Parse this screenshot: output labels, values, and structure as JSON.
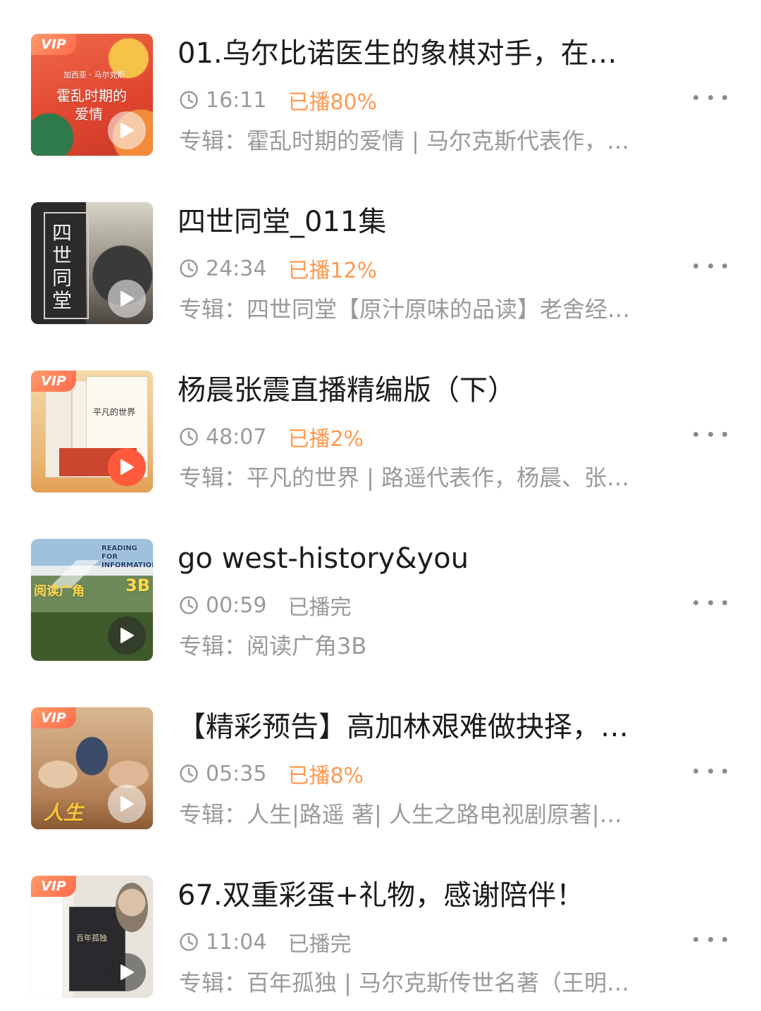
{
  "episodes": [
    {
      "title": "01.乌尔比诺医生的象棋对手，在…",
      "duration": "16:11",
      "played": "已播80%",
      "played_state": "partial",
      "album": "专辑：霍乱时期的爱情 | 马尔克斯代表作，…",
      "vip": "VIP",
      "cover_line1": "加西亚 · 马尔克斯",
      "cover_line2": "霍乱时期的",
      "cover_line3": "爱情",
      "cover_color": "#e8503a"
    },
    {
      "title": "四世同堂_011集",
      "duration": "24:34",
      "played": "已播12%",
      "played_state": "partial",
      "album": "专辑：四世同堂【原汁原味的品读】老舍经…",
      "vip": "",
      "cover_line1": "四",
      "cover_line2": "世",
      "cover_line3": "同",
      "cover_line4": "堂",
      "cover_color": "#5a5a5a"
    },
    {
      "title": "杨晨张震直播精编版（下）",
      "duration": "48:07",
      "played": "已播2%",
      "played_state": "partial",
      "album": "专辑：平凡的世界 | 路遥代表作，杨晨、张…",
      "vip": "VIP",
      "cover_line1": "平凡的世界",
      "cover_color": "#f0c48a"
    },
    {
      "title": "go west-history&you",
      "duration": "00:59",
      "played": "已播完",
      "played_state": "done",
      "album": "专辑：阅读广角3B",
      "vip": "",
      "cover_line1": "READING FOR INFORMATION",
      "cover_line2": "阅读广角",
      "cover_line3": "3B",
      "cover_color": "#4c6b2e"
    },
    {
      "title": "【精彩预告】高加林艰难做抉择，…",
      "duration": "05:35",
      "played": "已播8%",
      "played_state": "partial",
      "album": "专辑：人生|路遥 著| 人生之路电视剧原著|…",
      "vip": "VIP",
      "cover_line1": "人生",
      "cover_color": "#c89a6a"
    },
    {
      "title": "67.双重彩蛋+礼物，感谢陪伴！",
      "duration": "11:04",
      "played": "已播完",
      "played_state": "done",
      "album": "专辑：百年孤独 | 马尔克斯传世名著（王明…",
      "vip": "VIP",
      "cover_line1": "百年孤独",
      "cover_color": "#e9e6e0"
    }
  ],
  "icons": {
    "clock": "clock-icon",
    "play": "play-icon",
    "more": "more-options-icon"
  },
  "colors": {
    "played_partial": "#ff9a52",
    "muted": "#9a9a9a",
    "vip": "#ff6b4a"
  }
}
